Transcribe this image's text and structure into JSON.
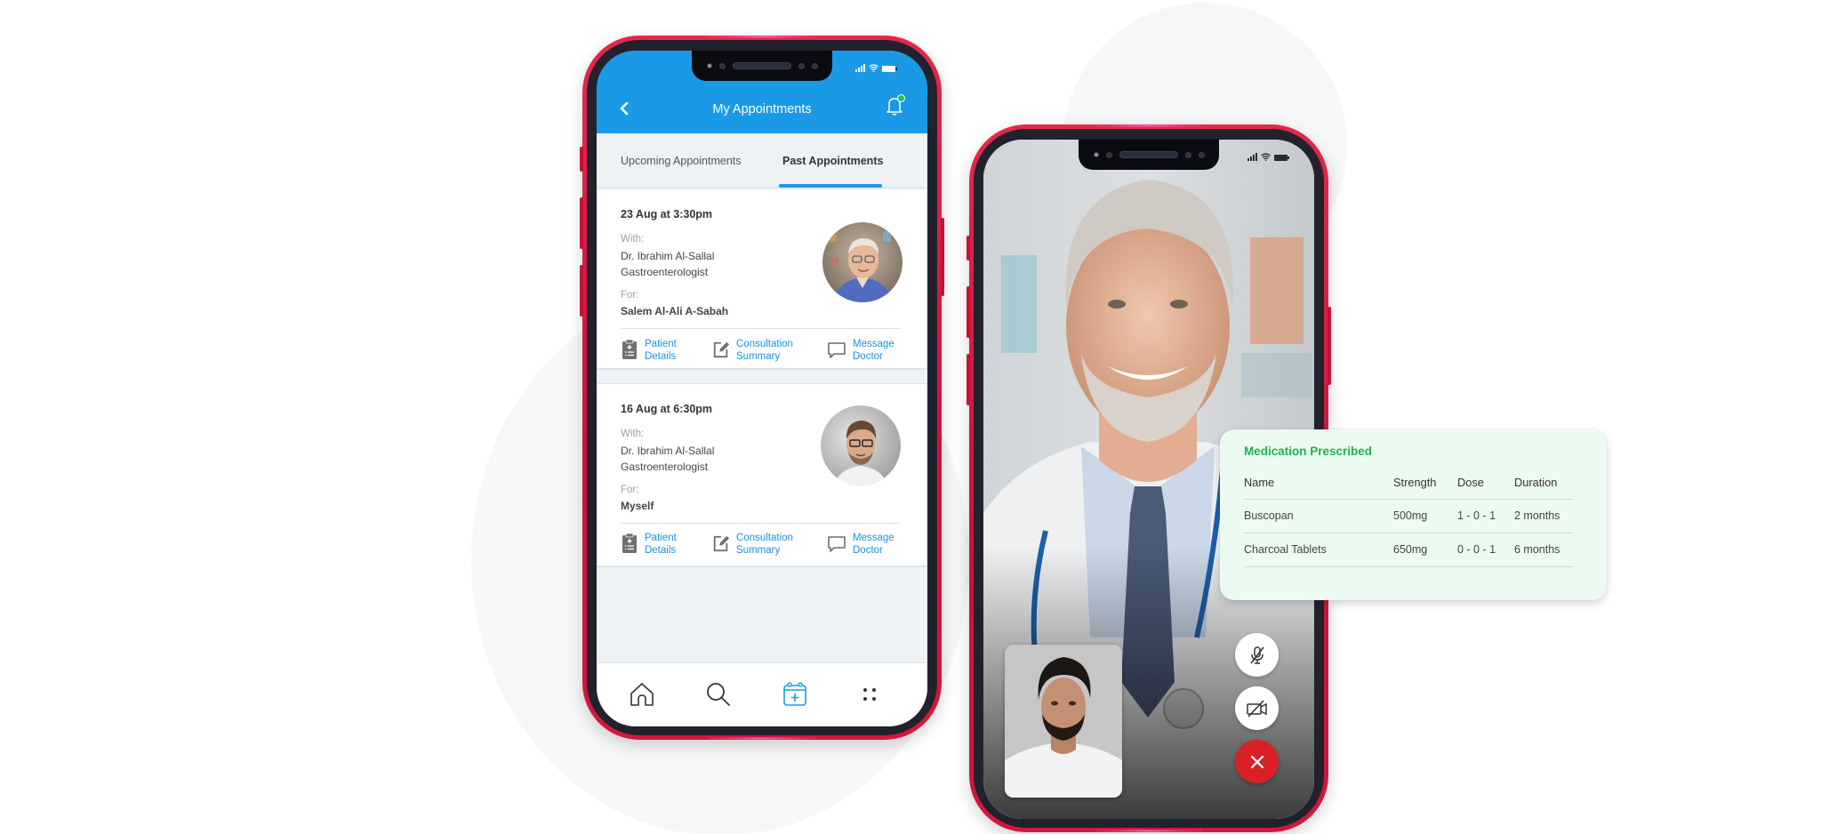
{
  "appointments_app": {
    "header": {
      "title": "My Appointments",
      "back_icon": "chevron-left-icon",
      "notification_icon": "bell-icon",
      "notification_badge_color": "#26c04a"
    },
    "tabs": [
      {
        "label": "Upcoming Appointments",
        "active": false
      },
      {
        "label": "Past Appointments",
        "active": true
      }
    ],
    "appointments": [
      {
        "date": "23 Aug at 3:30pm",
        "with_label": "With:",
        "doctor_name": "Dr. Ibrahim Al-Sallal",
        "specialty": "Gastroenterologist",
        "for_label": "For:",
        "patient": "Salem Al-Ali A-Sabah",
        "actions": [
          {
            "line1": "Patient",
            "line2": "Details",
            "icon": "clipboard-icon"
          },
          {
            "line1": "Consultation",
            "line2": "Summary",
            "icon": "edit-icon"
          },
          {
            "line1": "Message",
            "line2": "Doctor",
            "icon": "chat-icon"
          }
        ]
      },
      {
        "date": "16 Aug at 6:30pm",
        "with_label": "With:",
        "doctor_name": "Dr. Ibrahim Al-Sallal",
        "specialty": "Gastroenterologist",
        "for_label": "For:",
        "patient": "Myself",
        "actions": [
          {
            "line1": "Patient",
            "line2": "Details",
            "icon": "clipboard-icon"
          },
          {
            "line1": "Consultation",
            "line2": "Summary",
            "icon": "edit-icon"
          },
          {
            "line1": "Message",
            "line2": "Doctor",
            "icon": "chat-icon"
          }
        ]
      }
    ],
    "bottom_nav": [
      {
        "icon": "home-icon",
        "active": false
      },
      {
        "icon": "search-icon",
        "active": false
      },
      {
        "icon": "calendar-add-icon",
        "active": true
      },
      {
        "icon": "more-dots-icon",
        "active": false
      }
    ],
    "accent_color": "#1a9ae6"
  },
  "video_call": {
    "controls": [
      {
        "icon": "mic-off-icon",
        "label": "Mute microphone"
      },
      {
        "icon": "video-off-icon",
        "label": "Turn off camera"
      },
      {
        "icon": "close-icon",
        "label": "End call"
      }
    ],
    "end_call_color": "#d92027"
  },
  "medication": {
    "title": "Medication Prescribed",
    "title_color": "#21b24c",
    "columns": [
      "Name",
      "Strength",
      "Dose",
      "Duration"
    ],
    "rows": [
      [
        "Buscopan",
        "500mg",
        "1 - 0 - 1",
        "2 months"
      ],
      [
        "Charcoal Tablets",
        "650mg",
        "0 - 0 - 1",
        "6 months"
      ]
    ]
  }
}
